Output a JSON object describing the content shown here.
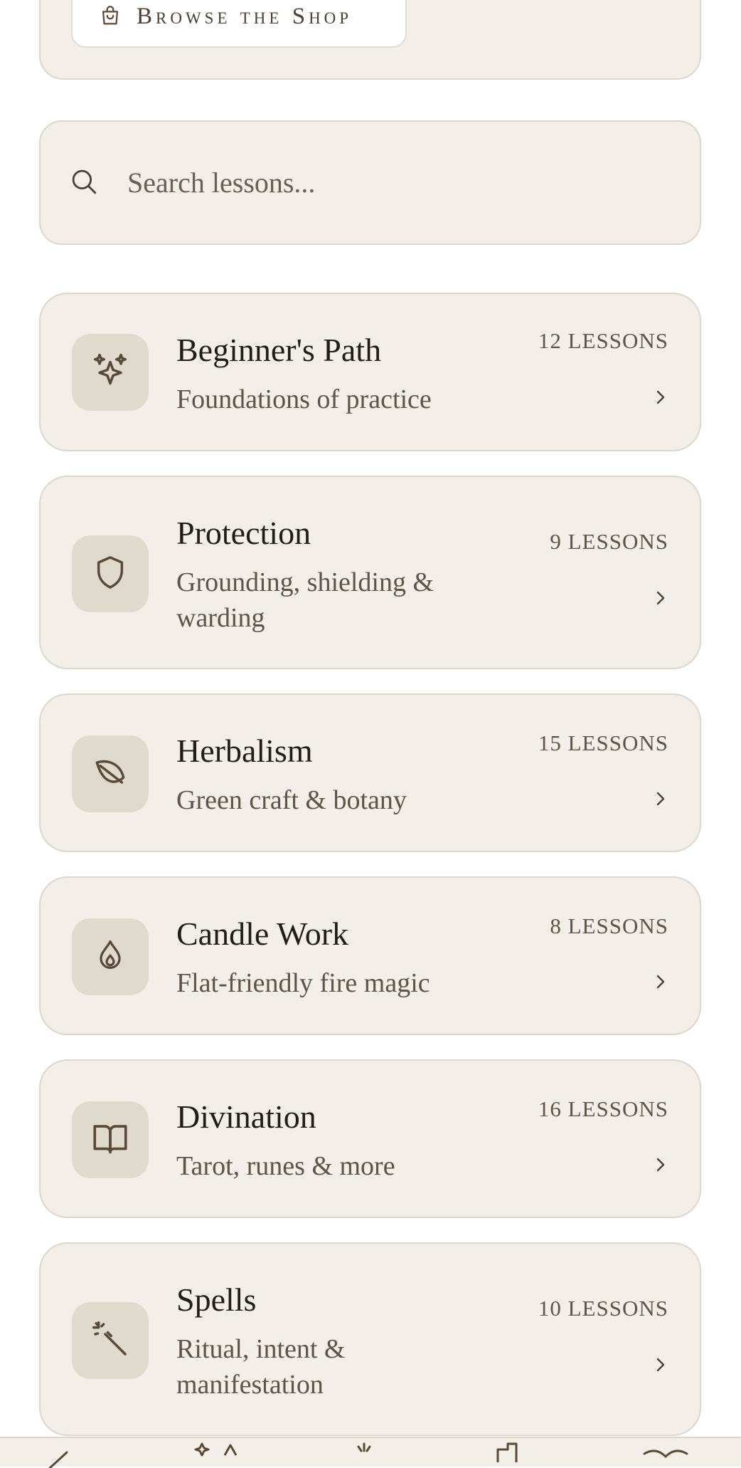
{
  "shop": {
    "button_label": "Browse the Shop",
    "icon": "shopping-bag-icon"
  },
  "search": {
    "placeholder": "Search lessons...",
    "icon": "search-icon"
  },
  "categories": [
    {
      "title": "Beginner's Path",
      "subtitle": "Foundations of practice",
      "count": "12 LESSONS",
      "icon": "sparkles-icon"
    },
    {
      "title": "Protection",
      "subtitle": "Grounding, shielding & warding",
      "count": "9 LESSONS",
      "icon": "shield-icon"
    },
    {
      "title": "Herbalism",
      "subtitle": "Green craft & botany",
      "count": "15 LESSONS",
      "icon": "leaf-icon"
    },
    {
      "title": "Candle Work",
      "subtitle": "Flat-friendly fire magic",
      "count": "8 LESSONS",
      "icon": "flame-icon"
    },
    {
      "title": "Divination",
      "subtitle": "Tarot, runes & more",
      "count": "16 LESSONS",
      "icon": "book-icon"
    },
    {
      "title": "Spells",
      "subtitle": "Ritual, intent & manifestation",
      "count": "10 LESSONS",
      "icon": "magic-wand-icon"
    }
  ],
  "colors": {
    "background": "#ffffff",
    "card": "#f3efe8",
    "border": "#ddd6cb",
    "icon_tile": "#e0dacd",
    "icon_stroke": "#5a4a35"
  }
}
